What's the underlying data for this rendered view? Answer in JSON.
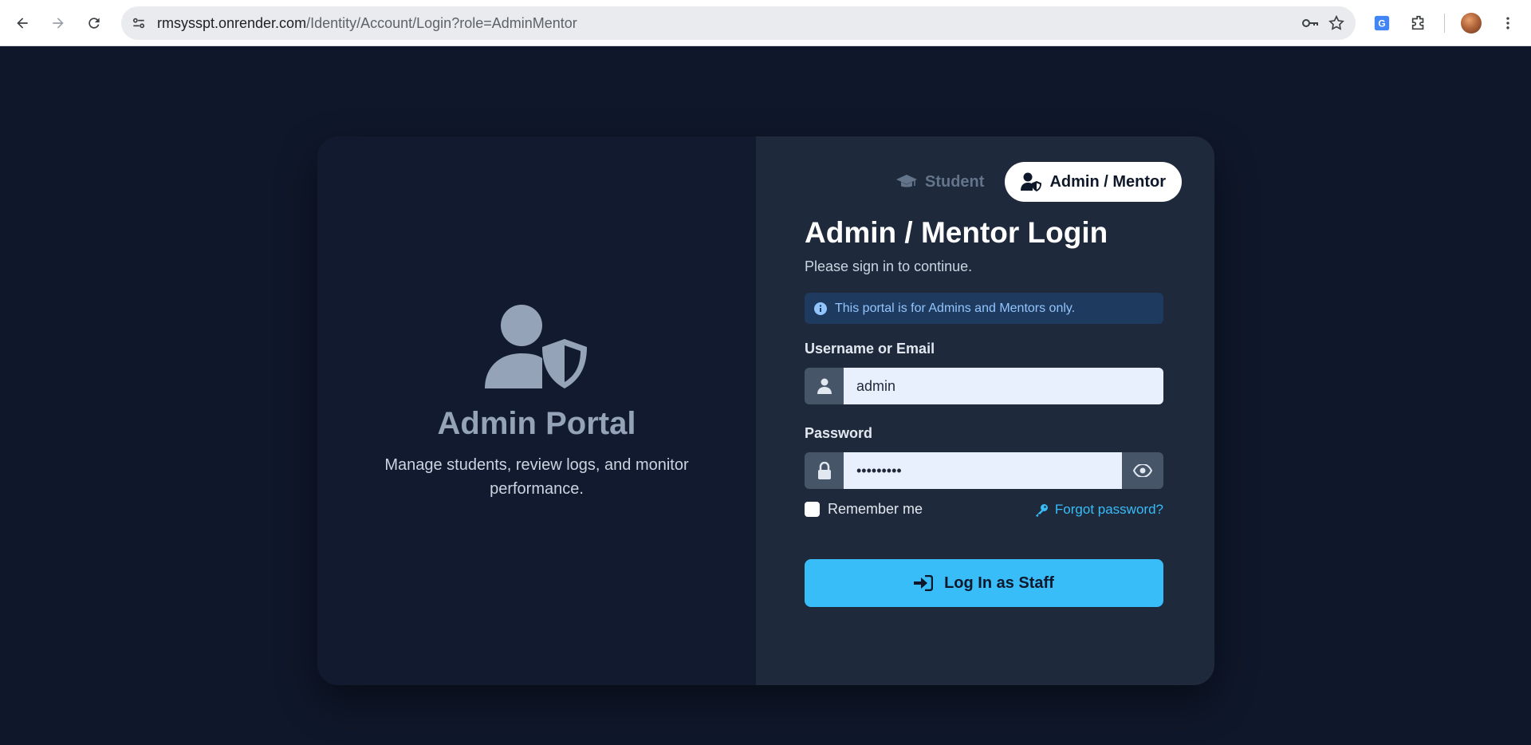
{
  "browser": {
    "url_host": "rmsysspt.onrender.com",
    "url_path": "/Identity/Account/Login?role=AdminMentor",
    "back_icon": "arrow-left-icon",
    "forward_icon": "arrow-right-icon",
    "reload_icon": "reload-icon"
  },
  "left_panel": {
    "icon": "user-shield-icon",
    "title": "Admin Portal",
    "description": "Manage students, review logs, and monitor performance."
  },
  "role_switch": {
    "student_label": "Student",
    "admin_label": "Admin / Mentor",
    "active": "admin"
  },
  "form": {
    "title": "Admin / Mentor Login",
    "subtitle": "Please sign in to continue.",
    "info_text": "This portal is for Admins and Mentors only.",
    "username_label": "Username or Email",
    "username_value": "admin",
    "password_label": "Password",
    "password_value": "•••••••••",
    "remember_label": "Remember me",
    "remember_checked": false,
    "forgot_label": "Forgot password?",
    "submit_label": "Log In as Staff"
  },
  "colors": {
    "background": "#0f172a",
    "left_pane": "#111a2e",
    "right_pane": "#1e293b",
    "accent": "#38bdf8",
    "info_bg": "#1e3a5f",
    "info_text": "#93c5fd"
  }
}
